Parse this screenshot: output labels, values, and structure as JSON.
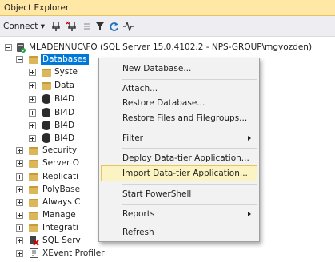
{
  "window": {
    "title": "Object Explorer"
  },
  "toolbar": {
    "connect_label": "Connect ▾"
  },
  "tree": {
    "server": "MLADENNUC\\FO (SQL Server 15.0.4102.2 - NPS-GROUP\\mgvozden)",
    "databases": "Databases",
    "db_children": [
      "Syste",
      "Data",
      "BI4D",
      "BI4D",
      "BI4D",
      "BI4D"
    ],
    "siblings": [
      "Security",
      "Server O",
      "Replicati",
      "PolyBase",
      "Always C",
      "Manage",
      "Integrati",
      "SQL Serv",
      "XEvent Profiler"
    ]
  },
  "context_menu": {
    "items": [
      "New Database...",
      "Attach...",
      "Restore Database...",
      "Restore Files and Filegroups...",
      "Filter",
      "Deploy Data-tier Application...",
      "Import Data-tier Application...",
      "Start PowerShell",
      "Reports",
      "Refresh"
    ],
    "hovered": "Import Data-tier Application..."
  }
}
